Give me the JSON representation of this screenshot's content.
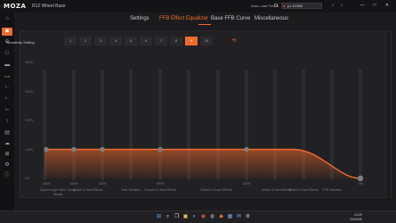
{
  "app": {
    "logo": "MOZA",
    "device": "R12 Wheel Base"
  },
  "titlebar": {
    "auto_load_label": "Auto Load Preset",
    "preset_value": "p1-51366",
    "controls": [
      "‹",
      "›",
      "—",
      "□",
      "✕"
    ]
  },
  "sidebar": {
    "items": [
      {
        "name": "home",
        "glyph": "⌂"
      },
      {
        "name": "wheelbase",
        "glyph": "◉",
        "active": true
      },
      {
        "name": "steering-wheel",
        "glyph": "⊖"
      },
      {
        "name": "users",
        "glyph": "⚇"
      },
      {
        "name": "dashboard",
        "glyph": "▬"
      },
      {
        "name": "hub",
        "glyph": "HUB"
      },
      {
        "name": "pedal",
        "glyph": "∟"
      },
      {
        "name": "pedal-2",
        "glyph": "∟"
      },
      {
        "name": "handbrake",
        "glyph": "⌙"
      },
      {
        "name": "shifter",
        "glyph": "↕"
      },
      {
        "name": "display",
        "glyph": "▤"
      },
      {
        "name": "cloud",
        "glyph": "☁"
      },
      {
        "name": "gamepad",
        "glyph": "⊞"
      },
      {
        "name": "settings",
        "glyph": "⚙"
      },
      {
        "name": "info",
        "glyph": "ⓘ"
      }
    ]
  },
  "tabs": [
    {
      "label": "Settings"
    },
    {
      "label": "FFB Effect Equalizer",
      "active": true
    },
    {
      "label": "Base FFB Curve"
    },
    {
      "label": "Miscellaneous"
    }
  ],
  "sensitivity": {
    "label": "Sensitivity Setting",
    "options": [
      "1",
      "2",
      "3",
      "4",
      "5",
      "6",
      "7",
      "8",
      "9",
      "10"
    ],
    "selected": "9",
    "reset_icon": "reset-icon"
  },
  "chart_data": {
    "type": "line",
    "y_ticks": [
      "400%",
      "300%",
      "200%",
      "100%",
      "0%"
    ],
    "ylim": [
      0,
      400
    ],
    "x": [
      "10Hz",
      "15Hz",
      "25Hz",
      "40Hz",
      "60Hz",
      "100Hz"
    ],
    "values": [
      100,
      100,
      100,
      100,
      100,
      0
    ],
    "value_labels": [
      "100%",
      "100%",
      "100%",
      "100%",
      "100%",
      "0%"
    ],
    "categories": [
      "Speed Angle Wind / Body Vibrate",
      "Wheel & Hard Effects",
      "Gain Vibration",
      "Ground & Hard Effects",
      "Wheel & Grass Effects",
      "Wheel & Hard Effects",
      "Wheel & Hard Effects",
      "FFB Vibration"
    ],
    "colors": {
      "line": "#f06a2a",
      "dot": "#7a7a80"
    }
  },
  "taskbar": {
    "icons": [
      "windows-icon",
      "search-icon",
      "task-view-icon",
      "explorer-icon",
      "edge-icon",
      "chrome-icon",
      "steam-icon",
      "moza-icon",
      "store-icon",
      "mail-icon",
      "settings-icon"
    ],
    "tray_time": "13:29",
    "tray_date": "2023/4/5"
  }
}
